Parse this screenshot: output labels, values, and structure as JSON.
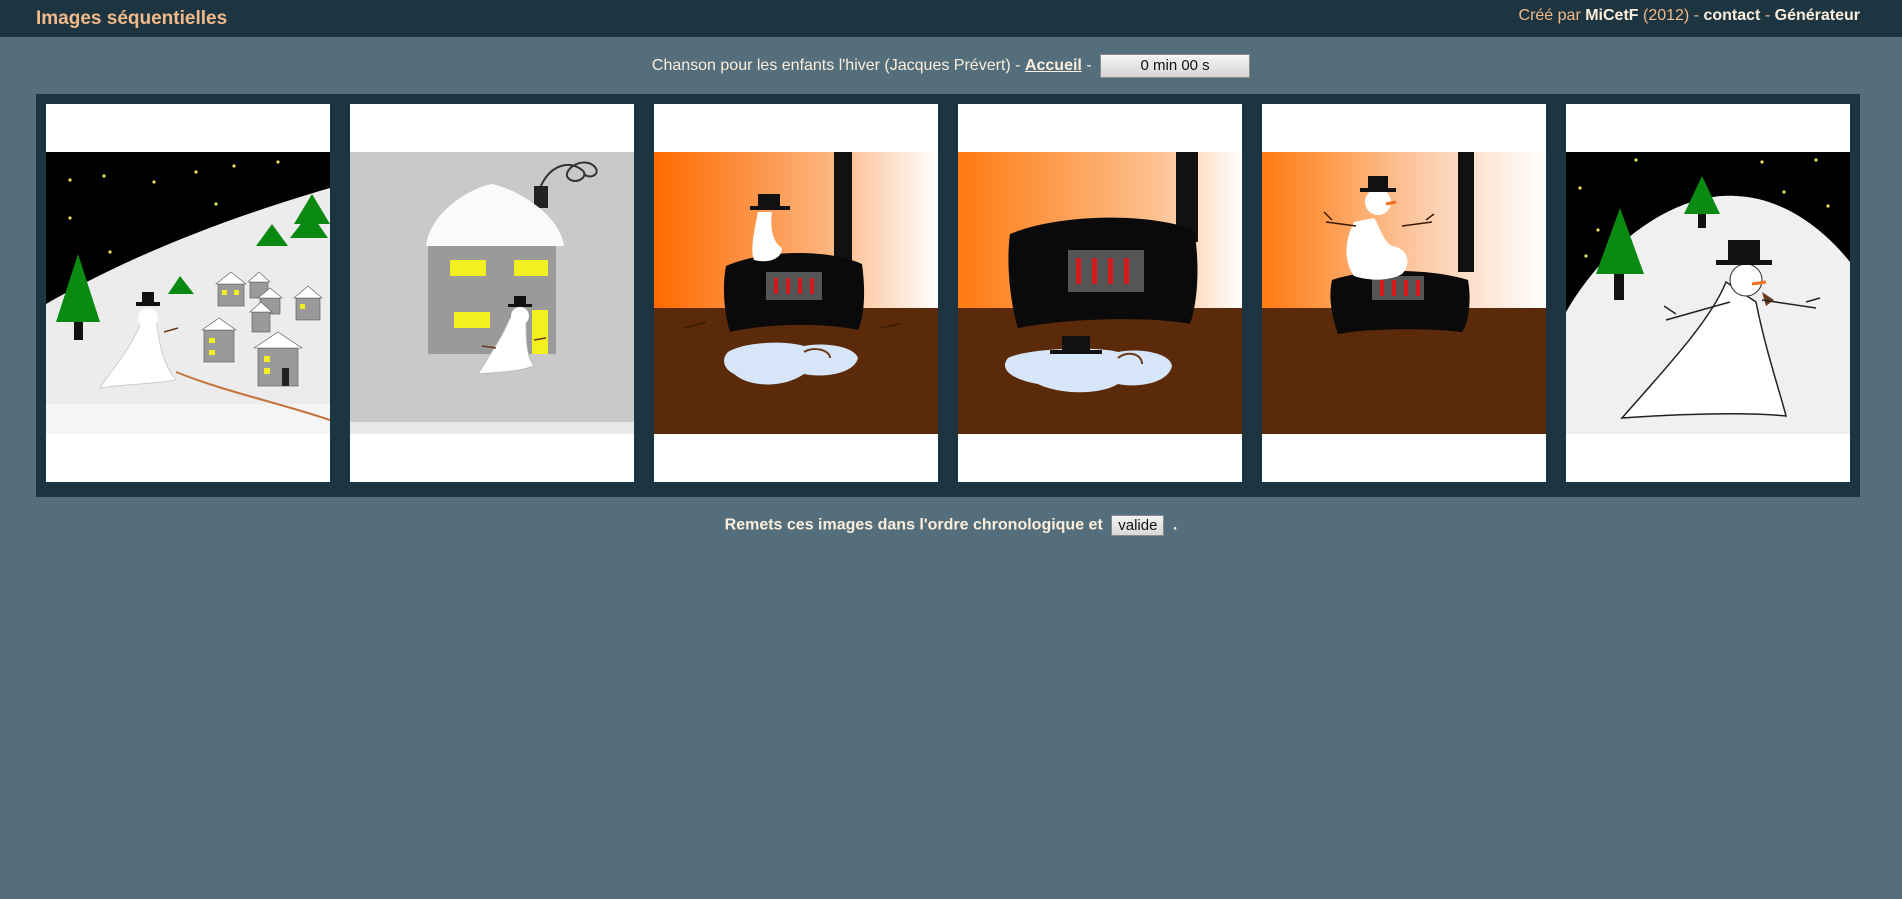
{
  "header": {
    "title": "Images séquentielles",
    "created_by_prefix": "Créé par",
    "author": "MiCetF",
    "year": "(2012)",
    "separator": "-",
    "contact_link": "contact",
    "generator_link": "Générateur"
  },
  "subtitle": {
    "song": "Chanson pour les enfants l'hiver (Jacques Prévert)",
    "separator": "-",
    "home_link": "Accueil",
    "timer": "0 min 00 s"
  },
  "images": [
    {
      "icon": "snowman-village-night-image"
    },
    {
      "icon": "snowman-house-door-image"
    },
    {
      "icon": "snowman-on-stove-melting-image"
    },
    {
      "icon": "melted-snowman-hat-stove-image"
    },
    {
      "icon": "snowman-sitting-on-stove-image"
    },
    {
      "icon": "snowman-hill-night-image"
    }
  ],
  "instruction": {
    "text": "Remets ces images dans l'ordre chronologique et",
    "button_label": "valide",
    "end": "."
  },
  "colors": {
    "background": "#546e7c",
    "header": "#1d3540",
    "title_accent": "#f2b98a",
    "text": "#fbeedc"
  }
}
